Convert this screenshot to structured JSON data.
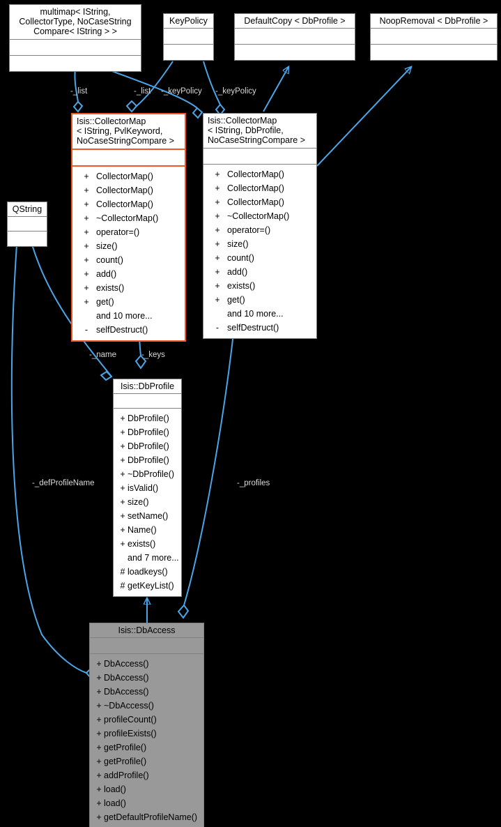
{
  "diagram": {
    "title": "Isis::DbAccess class collaboration diagram",
    "background": "#000000",
    "accent_color": "#f1562a",
    "edge_color": "#4ba6e8",
    "label_color": "#d9d9d9",
    "filled_color": "#999999"
  },
  "classes": {
    "multimap": {
      "name": "multimap< IString,\nCollectorType, NoCaseString\nCompare< IString > >",
      "attributes": [],
      "operations": []
    },
    "keypolicy": {
      "name": "KeyPolicy",
      "attributes": [],
      "operations": []
    },
    "defaultcopy": {
      "name": "DefaultCopy < DbProfile  >",
      "attributes": [],
      "operations": []
    },
    "noopremoval": {
      "name": "NoopRemoval < DbProfile  >",
      "attributes": [],
      "operations": []
    },
    "qstring": {
      "name": "QString",
      "attributes": [],
      "operations": []
    },
    "collectormap_pvl": {
      "name": "Isis::CollectorMap\n< IString, PvlKeyword,\n NoCaseStringCompare >",
      "attributes": [],
      "operations": [
        {
          "vis": "+",
          "label": "CollectorMap()"
        },
        {
          "vis": "+",
          "label": "CollectorMap()"
        },
        {
          "vis": "+",
          "label": "CollectorMap()"
        },
        {
          "vis": "+",
          "label": "~CollectorMap()"
        },
        {
          "vis": "+",
          "label": "operator=()"
        },
        {
          "vis": "+",
          "label": "size()"
        },
        {
          "vis": "+",
          "label": "count()"
        },
        {
          "vis": "+",
          "label": "add()"
        },
        {
          "vis": "+",
          "label": "exists()"
        },
        {
          "vis": "+",
          "label": "get()"
        },
        {
          "vis": "",
          "label": "and 10 more..."
        },
        {
          "vis": "-",
          "label": "selfDestruct()"
        }
      ]
    },
    "collectormap_db": {
      "name": "Isis::CollectorMap\n< IString, DbProfile,\n NoCaseStringCompare >",
      "attributes": [],
      "operations": [
        {
          "vis": "+",
          "label": "CollectorMap()"
        },
        {
          "vis": "+",
          "label": "CollectorMap()"
        },
        {
          "vis": "+",
          "label": "CollectorMap()"
        },
        {
          "vis": "+",
          "label": "~CollectorMap()"
        },
        {
          "vis": "+",
          "label": "operator=()"
        },
        {
          "vis": "+",
          "label": "size()"
        },
        {
          "vis": "+",
          "label": "count()"
        },
        {
          "vis": "+",
          "label": "add()"
        },
        {
          "vis": "+",
          "label": "exists()"
        },
        {
          "vis": "+",
          "label": "get()"
        },
        {
          "vis": "",
          "label": "and 10 more..."
        },
        {
          "vis": "-",
          "label": "selfDestruct()"
        }
      ]
    },
    "dbprofile": {
      "name": "Isis::DbProfile",
      "attributes": [],
      "operations": [
        {
          "vis": "+",
          "label": "DbProfile()"
        },
        {
          "vis": "+",
          "label": "DbProfile()"
        },
        {
          "vis": "+",
          "label": "DbProfile()"
        },
        {
          "vis": "+",
          "label": "DbProfile()"
        },
        {
          "vis": "+",
          "label": "~DbProfile()"
        },
        {
          "vis": "+",
          "label": "isValid()"
        },
        {
          "vis": "+",
          "label": "size()"
        },
        {
          "vis": "+",
          "label": "setName()"
        },
        {
          "vis": "+",
          "label": "Name()"
        },
        {
          "vis": "+",
          "label": "exists()"
        },
        {
          "vis": "",
          "label": "and 7 more..."
        },
        {
          "vis": "#",
          "label": "loadkeys()"
        },
        {
          "vis": "#",
          "label": "getKeyList()"
        }
      ]
    },
    "dbaccess": {
      "name": "Isis::DbAccess",
      "attributes": [],
      "operations": [
        {
          "vis": "+",
          "label": "DbAccess()"
        },
        {
          "vis": "+",
          "label": "DbAccess()"
        },
        {
          "vis": "+",
          "label": "DbAccess()"
        },
        {
          "vis": "+",
          "label": "~DbAccess()"
        },
        {
          "vis": "+",
          "label": "profileCount()"
        },
        {
          "vis": "+",
          "label": "profileExists()"
        },
        {
          "vis": "+",
          "label": "getProfile()"
        },
        {
          "vis": "+",
          "label": "getProfile()"
        },
        {
          "vis": "+",
          "label": "addProfile()"
        },
        {
          "vis": "+",
          "label": "load()"
        },
        {
          "vis": "+",
          "label": "load()"
        },
        {
          "vis": "+",
          "label": "getDefaultProfileName()"
        }
      ]
    }
  },
  "edge_labels": {
    "list_left": "-_list",
    "list_right": "-_list",
    "keypolicy_left": "-_keyPolicy",
    "keypolicy_right": "-_keyPolicy",
    "name": "-_name",
    "keys": "-_keys",
    "defprofilename": "-_defProfileName",
    "profiles": "-_profiles"
  }
}
